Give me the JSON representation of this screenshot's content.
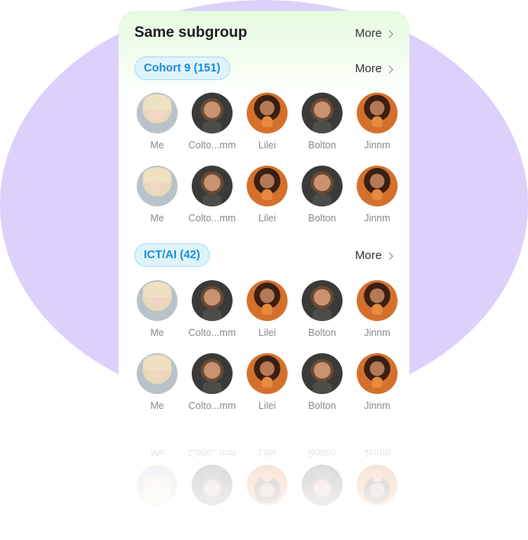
{
  "card": {
    "title": "Same subgroup",
    "more_label": "More"
  },
  "groups": [
    {
      "chip": "Cohort 9 (151)",
      "more_label": "More",
      "rows": [
        [
          {
            "name": "Me",
            "avatar": "blonde"
          },
          {
            "name": "Colto...mm",
            "avatar": "man"
          },
          {
            "name": "Lilei",
            "avatar": "woman"
          },
          {
            "name": "Bolton",
            "avatar": "man"
          },
          {
            "name": "Jinnm",
            "avatar": "woman"
          }
        ],
        [
          {
            "name": "Me",
            "avatar": "blonde"
          },
          {
            "name": "Colto...mm",
            "avatar": "man"
          },
          {
            "name": "Lilei",
            "avatar": "woman"
          },
          {
            "name": "Bolton",
            "avatar": "man"
          },
          {
            "name": "Jinnm",
            "avatar": "woman"
          }
        ]
      ]
    },
    {
      "chip": "ICT/AI (42)",
      "more_label": "More",
      "rows": [
        [
          {
            "name": "Me",
            "avatar": "blonde"
          },
          {
            "name": "Colto...mm",
            "avatar": "man"
          },
          {
            "name": "Lilei",
            "avatar": "woman"
          },
          {
            "name": "Bolton",
            "avatar": "man"
          },
          {
            "name": "Jinnm",
            "avatar": "woman"
          }
        ],
        [
          {
            "name": "Me",
            "avatar": "blonde"
          },
          {
            "name": "Colto...mm",
            "avatar": "man"
          },
          {
            "name": "Lilei",
            "avatar": "woman"
          },
          {
            "name": "Bolton",
            "avatar": "man"
          },
          {
            "name": "Jinnm",
            "avatar": "woman"
          }
        ]
      ]
    }
  ],
  "colors": {
    "background_blob": "#ddd0fb",
    "chip_text": "#1a90d6",
    "chip_bg": "#dff3fb",
    "header_tint": "#e6fbe0"
  }
}
